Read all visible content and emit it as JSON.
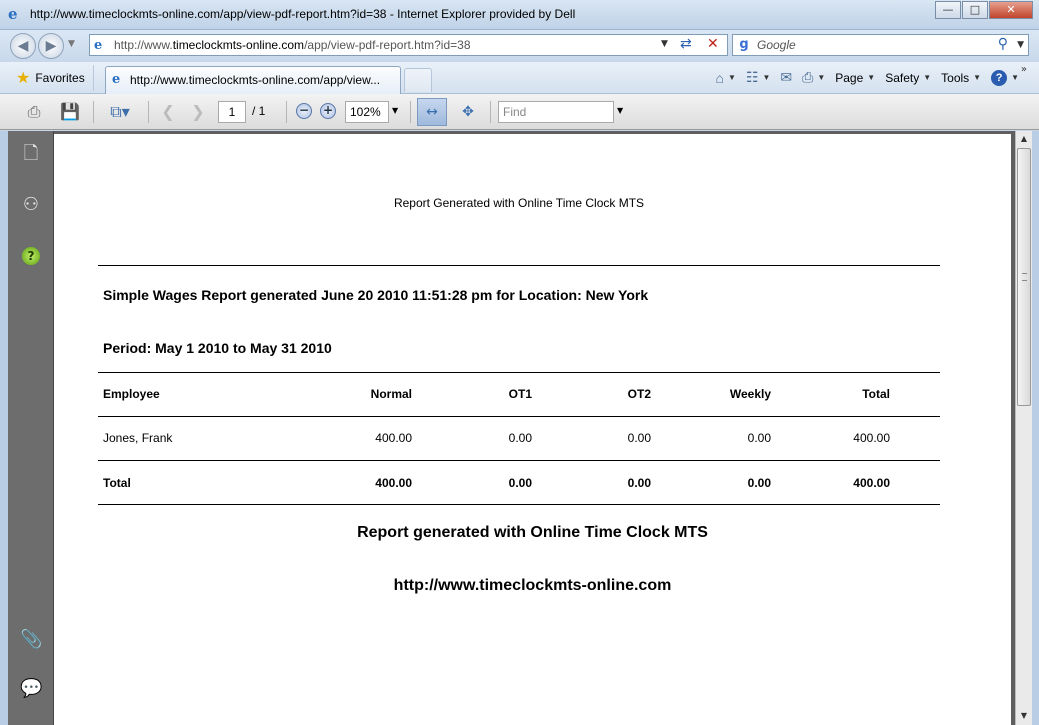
{
  "window": {
    "title": "http://www.timeclockmts-online.com/app/view-pdf-report.htm?id=38 - Internet Explorer provided by Dell",
    "minimize_label": "▭",
    "maximize_label": "▢",
    "close_label": "✕"
  },
  "address": {
    "url_prefix": "http://www.",
    "url_domain": "timeclockmts-online.com",
    "url_path": "/app/view-pdf-report.htm?id=38"
  },
  "search": {
    "placeholder": "Google"
  },
  "favorites": {
    "label": "Favorites"
  },
  "tabs": [
    {
      "label": "http://www.timeclockmts-online.com/app/view..."
    }
  ],
  "commands": {
    "page": "Page",
    "safety": "Safety",
    "tools": "Tools"
  },
  "pdf_toolbar": {
    "page_current": "1",
    "page_total": "/ 1",
    "zoom": "102%",
    "find_placeholder": "Find"
  },
  "report": {
    "header": "Report Generated with Online Time Clock MTS",
    "title": "Simple Wages Report generated June 20 2010 11:51:28 pm for Location: New York",
    "period": "Period: May 1 2010 to May 31 2010",
    "columns": [
      "Employee",
      "Normal",
      "OT1",
      "OT2",
      "Weekly",
      "Total"
    ],
    "rows": [
      [
        "Jones, Frank",
        "400.00",
        "0.00",
        "0.00",
        "0.00",
        "400.00"
      ]
    ],
    "totals": [
      "Total",
      "400.00",
      "0.00",
      "0.00",
      "0.00",
      "400.00"
    ],
    "footer_line1": "Report generated with Online Time Clock MTS",
    "footer_line2": "http://www.timeclockmts-online.com"
  },
  "icons": {
    "browser": "ie-logo-icon",
    "favorites": "star-icon",
    "home": "home-icon",
    "feeds": "rss-icon",
    "mail": "mail-icon",
    "print": "printer-icon",
    "help": "help-icon",
    "pages_panel": "pages-icon",
    "search_panel": "binoculars-icon",
    "help_panel": "help-icon",
    "attachments": "paperclip-icon",
    "comments": "comments-icon"
  }
}
